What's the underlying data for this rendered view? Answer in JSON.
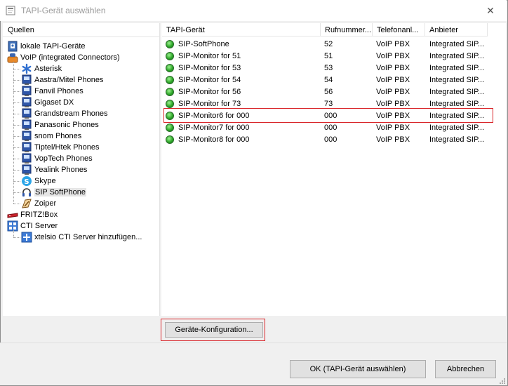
{
  "window": {
    "title": "TAPI-Gerät auswählen",
    "close_glyph": "✕"
  },
  "sources": {
    "header": "Quellen",
    "items": [
      {
        "label": "lokale TAPI-Geräte",
        "icon": "phone-book-icon",
        "level": 0
      },
      {
        "label": "VoIP (integrated Connectors)",
        "icon": "voip-phone-icon",
        "level": 0
      },
      {
        "label": "Asterisk",
        "icon": "asterisk-icon",
        "level": 1
      },
      {
        "label": "Aastra/Mitel Phones",
        "icon": "desk-phone-icon",
        "level": 1
      },
      {
        "label": "Fanvil Phones",
        "icon": "desk-phone-icon",
        "level": 1
      },
      {
        "label": "Gigaset DX",
        "icon": "desk-phone-icon",
        "level": 1
      },
      {
        "label": "Grandstream Phones",
        "icon": "desk-phone-icon",
        "level": 1
      },
      {
        "label": "Panasonic Phones",
        "icon": "desk-phone-icon",
        "level": 1
      },
      {
        "label": "snom Phones",
        "icon": "desk-phone-icon",
        "level": 1
      },
      {
        "label": "Tiptel/Htek Phones",
        "icon": "desk-phone-icon",
        "level": 1
      },
      {
        "label": "VopTech Phones",
        "icon": "desk-phone-icon",
        "level": 1
      },
      {
        "label": "Yealink Phones",
        "icon": "desk-phone-icon",
        "level": 1
      },
      {
        "label": "Skype",
        "icon": "skype-icon",
        "level": 1
      },
      {
        "label": "SIP SoftPhone",
        "icon": "headset-icon",
        "level": 1,
        "selected": true
      },
      {
        "label": "Zoiper",
        "icon": "zoiper-icon",
        "level": 1
      },
      {
        "label": "FRITZ!Box",
        "icon": "fritzbox-icon",
        "level": 0
      },
      {
        "label": "CTI Server",
        "icon": "server-network-icon",
        "level": 0
      },
      {
        "label": "xtelsio CTI Server hinzufügen...",
        "icon": "add-server-icon",
        "level": 1
      }
    ]
  },
  "devices": {
    "columns": [
      "TAPI-Gerät",
      "Rufnummer...",
      "Telefonanl...",
      "Anbieter"
    ],
    "rows": [
      {
        "name": "SIP-SoftPhone",
        "number": "52",
        "pbx": "VoIP PBX",
        "provider": "Integrated SIP..."
      },
      {
        "name": "SIP-Monitor for 51",
        "number": "51",
        "pbx": "VoIP PBX",
        "provider": "Integrated SIP..."
      },
      {
        "name": "SIP-Monitor for 53",
        "number": "53",
        "pbx": "VoIP PBX",
        "provider": "Integrated SIP..."
      },
      {
        "name": "SIP-Monitor for 54",
        "number": "54",
        "pbx": "VoIP PBX",
        "provider": "Integrated SIP..."
      },
      {
        "name": "SIP-Monitor for 56",
        "number": "56",
        "pbx": "VoIP PBX",
        "provider": "Integrated SIP..."
      },
      {
        "name": "SIP-Monitor for 73",
        "number": "73",
        "pbx": "VoIP PBX",
        "provider": "Integrated SIP..."
      },
      {
        "name": "SIP-Monitor6 for 000",
        "number": "000",
        "pbx": "VoIP PBX",
        "provider": "Integrated SIP..."
      },
      {
        "name": "SIP-Monitor7 for 000",
        "number": "000",
        "pbx": "VoIP PBX",
        "provider": "Integrated SIP..."
      },
      {
        "name": "SIP-Monitor8 for 000",
        "number": "000",
        "pbx": "VoIP PBX",
        "provider": "Integrated SIP..."
      }
    ]
  },
  "buttons": {
    "config": "Geräte-Konfiguration...",
    "ok": "OK  (TAPI-Gerät auswählen)",
    "cancel": "Abbrechen"
  },
  "colors": {
    "highlight": "#d9262a",
    "status_online": "#2fa82a"
  }
}
